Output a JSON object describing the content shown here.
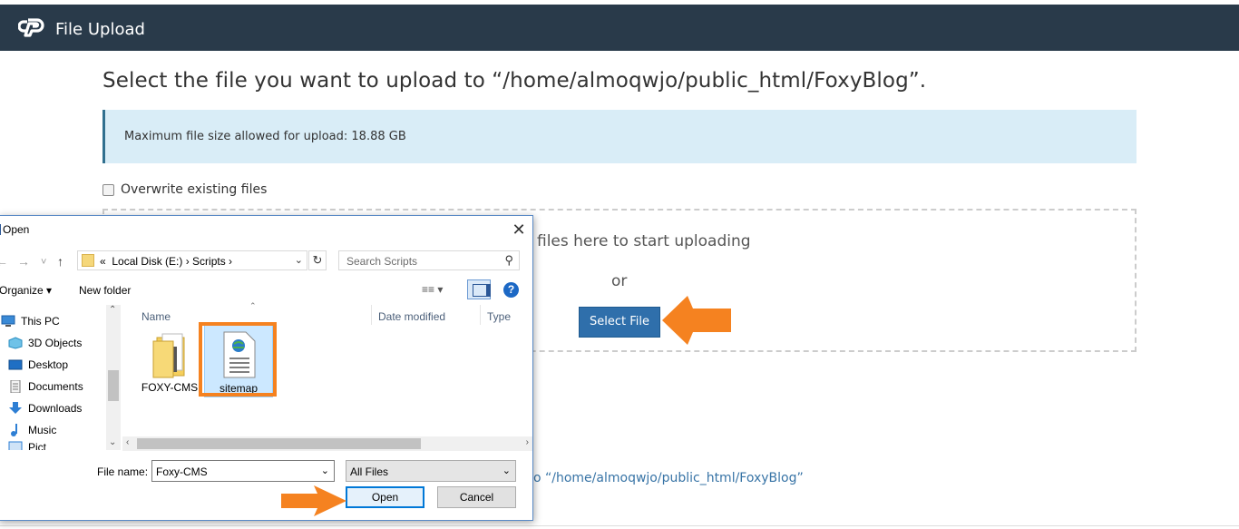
{
  "header": {
    "title": "File Upload"
  },
  "page": {
    "headline": "Select the file you want to upload to “/home/almoqwjo/public_html/FoxyBlog”.",
    "max_size_notice": "Maximum file size allowed for upload: 18.88 GB",
    "overwrite_label": "Overwrite existing files",
    "drop_text": "files here to start uploading",
    "or_text": "or",
    "select_button": "Select File",
    "back_link": "o “/home/almoqwjo/public_html/FoxyBlog”"
  },
  "colors": {
    "header_bg": "#293a4a",
    "accent": "#2f6fab",
    "annotation": "#f58220",
    "alert_bg": "#d9edf7"
  },
  "dialog": {
    "title": "Open",
    "close": "✕",
    "nav": {
      "back": "←",
      "forward": "→",
      "recent": "˅",
      "up": "↑"
    },
    "address": {
      "prefix": "«",
      "parts": "Local Disk (E:)  ›  Scripts  ›"
    },
    "search_placeholder": "Search Scripts",
    "toolbar": {
      "organize": "Organize ▾",
      "new_folder": "New folder"
    },
    "nav_pane": [
      {
        "label": "This PC",
        "icon": "pc-icon"
      },
      {
        "label": "3D Objects",
        "icon": "cube-icon"
      },
      {
        "label": "Desktop",
        "icon": "desktop-icon"
      },
      {
        "label": "Documents",
        "icon": "document-icon"
      },
      {
        "label": "Downloads",
        "icon": "download-icon"
      },
      {
        "label": "Music",
        "icon": "music-icon"
      },
      {
        "label": "Pict",
        "icon": "picture-icon"
      }
    ],
    "columns": {
      "name": "Name",
      "date": "Date modified",
      "type": "Type"
    },
    "files": [
      {
        "label": "FOXY-CMS",
        "icon": "folder-icon"
      },
      {
        "label": "sitemap",
        "icon": "xml-file-icon",
        "selected": true
      }
    ],
    "file_name_label": "File name:",
    "file_name_value": "Foxy-CMS",
    "file_type_value": "All Files",
    "open_button": "Open",
    "cancel_button": "Cancel"
  }
}
